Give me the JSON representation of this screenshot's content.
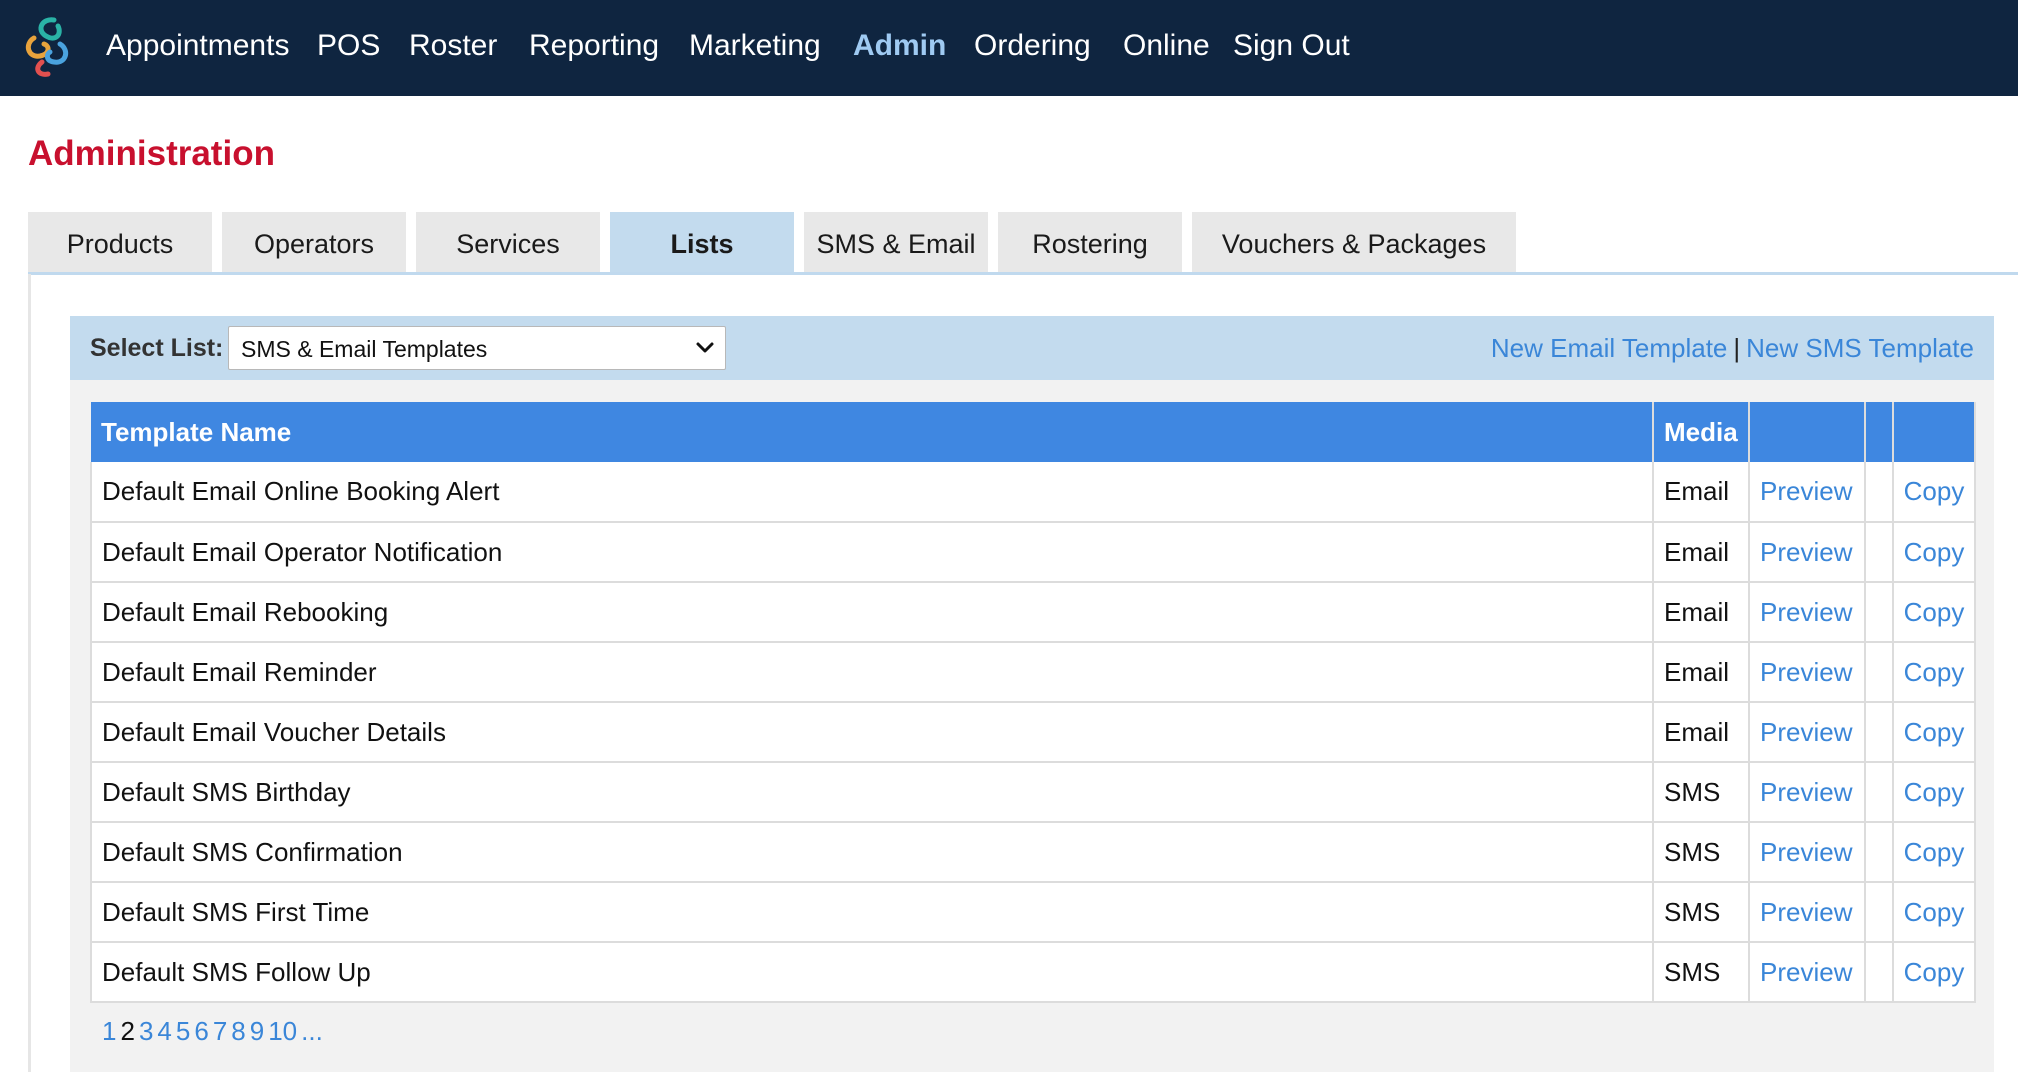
{
  "nav": {
    "items": [
      "Appointments",
      "POS",
      "Roster",
      "Reporting",
      "Marketing",
      "Admin",
      "Ordering",
      "Online",
      "Sign Out"
    ],
    "active": "Admin",
    "logo": "app-logo-icon"
  },
  "page": {
    "title": "Administration"
  },
  "tabs": [
    "Products",
    "Operators",
    "Services",
    "Lists",
    "SMS & Email",
    "Rostering",
    "Vouchers & Packages"
  ],
  "active_tab": "Lists",
  "select_list": {
    "label": "Select List:",
    "value": "SMS & Email Templates",
    "icon": "chevron-down-icon"
  },
  "actions": {
    "new_email": "New Email Template",
    "separator": "|",
    "new_sms": "New SMS Template"
  },
  "table": {
    "headers": [
      "Template Name",
      "Media",
      "",
      "",
      ""
    ],
    "rows": [
      {
        "name": "Default Email Online Booking Alert",
        "media": "Email",
        "preview": "Preview",
        "copy": "Copy"
      },
      {
        "name": "Default Email Operator Notification",
        "media": "Email",
        "preview": "Preview",
        "copy": "Copy"
      },
      {
        "name": "Default Email Rebooking",
        "media": "Email",
        "preview": "Preview",
        "copy": "Copy"
      },
      {
        "name": "Default Email Reminder",
        "media": "Email",
        "preview": "Preview",
        "copy": "Copy"
      },
      {
        "name": "Default Email Voucher Details",
        "media": "Email",
        "preview": "Preview",
        "copy": "Copy"
      },
      {
        "name": "Default SMS Birthday",
        "media": "SMS",
        "preview": "Preview",
        "copy": "Copy"
      },
      {
        "name": "Default SMS Confirmation",
        "media": "SMS",
        "preview": "Preview",
        "copy": "Copy"
      },
      {
        "name": "Default SMS First Time",
        "media": "SMS",
        "preview": "Preview",
        "copy": "Copy"
      },
      {
        "name": "Default SMS Follow Up",
        "media": "SMS",
        "preview": "Preview",
        "copy": "Copy"
      }
    ]
  },
  "pagination": {
    "pages": [
      "1",
      "2",
      "3",
      "4",
      "5",
      "6",
      "7",
      "8",
      "9",
      "10",
      "..."
    ],
    "current": "2"
  },
  "colors": {
    "topbar": "#0f2540",
    "title": "#c8102e",
    "accent": "#3f87e1",
    "link": "#3a86d8",
    "tab_active": "#c3dbee"
  }
}
